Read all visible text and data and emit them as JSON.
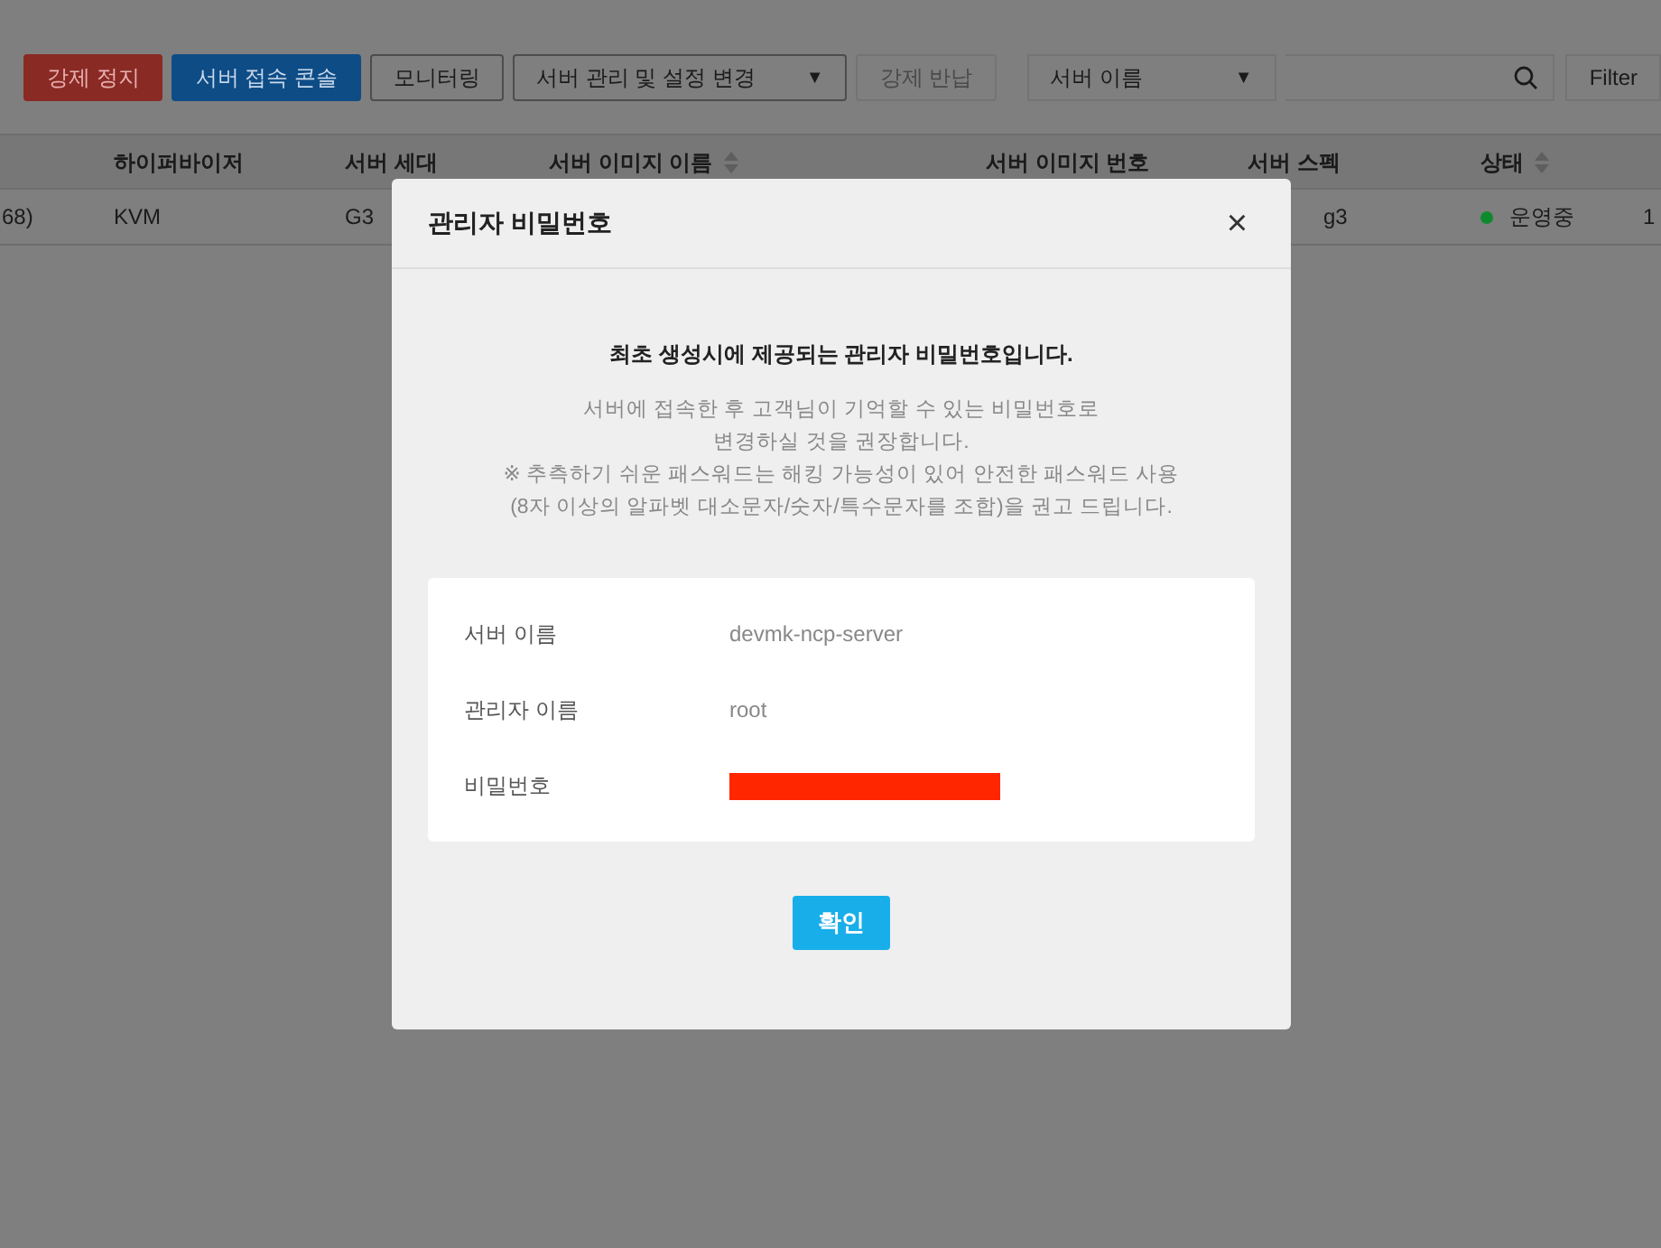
{
  "toolbar": {
    "buttons": [
      {
        "label": "강제 정지",
        "kind": "danger",
        "disabled": false
      },
      {
        "label": "서버 접속 콘솔",
        "kind": "primary",
        "disabled": false
      },
      {
        "label": "모니터링",
        "kind": "outline",
        "disabled": false
      },
      {
        "label": "서버 관리 및 설정 변경",
        "kind": "dropdown",
        "caret": "▼",
        "disabled": false
      },
      {
        "label": "강제 반납",
        "kind": "outline",
        "disabled": true
      }
    ],
    "search": {
      "select": "서버 이름",
      "caret": "▼"
    },
    "filter_button": "Filter"
  },
  "table": {
    "columns": [
      {
        "sortable": false
      },
      {
        "label": "하이퍼바이저",
        "sortable": false
      },
      {
        "label": "서버 세대",
        "sortable": false
      },
      {
        "label": "서버 이미지 이름",
        "sortable": true
      },
      {
        "label": "서버 이미지 번호",
        "sortable": false
      },
      {
        "label": "서버 스펙",
        "sortable": false
      },
      {
        "label": "상태",
        "sortable": true
      },
      {
        "sortable": false
      }
    ],
    "rows": [
      {
        "cells": [
          {
            "text": "68)"
          },
          {
            "text": "KVM"
          },
          {
            "text": "G3"
          },
          {},
          {},
          {
            "text": "g3"
          },
          {
            "text": "운영중",
            "color": "#0e8a2e"
          },
          {
            "text": "1"
          }
        ]
      }
    ]
  },
  "dialog": {
    "title": "관리자 비밀번호",
    "close": "×",
    "headline": "최초 생성시에 제공되는 관리자 비밀번호입니다.",
    "notes": [
      "서버에 접속한 후 고객님이 기억할 수 있는 비밀번호로",
      "변경하실 것을 권장합니다.",
      "※ 추측하기 쉬운 패스워드는 해킹 가능성이 있어 안전한 패스워드 사용",
      "(8자 이상의 알파벳 대소문자/숫자/특수문자를 조합)을 권고 드립니다."
    ],
    "fields": [
      {
        "label": "서버 이름",
        "value": "devmk-ncp-server",
        "kind": "text"
      },
      {
        "label": "관리자 이름",
        "value": "root",
        "kind": "text"
      },
      {
        "label": "비밀번호",
        "kind": "redacted"
      }
    ],
    "ok_button": "확인"
  }
}
